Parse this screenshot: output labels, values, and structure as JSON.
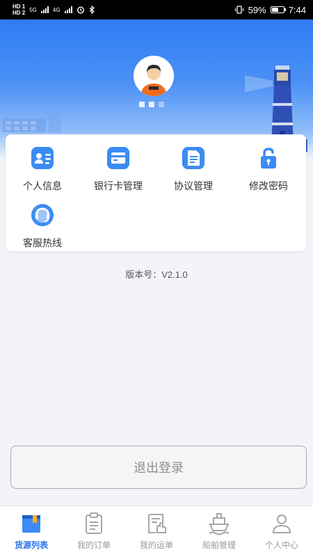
{
  "status_bar": {
    "hd_top": "HD 1",
    "hd_bottom": "HD 2",
    "net1": "5G",
    "net2": "4G",
    "battery_percent": "59%",
    "battery_level": 0.59,
    "time": "7:44"
  },
  "menu": [
    {
      "label": "个人信息",
      "icon": "id-card-icon"
    },
    {
      "label": "银行卡管理",
      "icon": "bank-card-icon"
    },
    {
      "label": "协议管理",
      "icon": "document-icon"
    },
    {
      "label": "修改密码",
      "icon": "unlock-icon"
    },
    {
      "label": "客服热线",
      "icon": "headset-icon"
    }
  ],
  "version": "版本号：V2.1.0",
  "logout_label": "退出登录",
  "tabs": [
    {
      "label": "货源列表",
      "icon": "book-icon",
      "active": true
    },
    {
      "label": "我的订单",
      "icon": "clipboard-icon",
      "active": false
    },
    {
      "label": "我的运单",
      "icon": "waybill-icon",
      "active": false
    },
    {
      "label": "船舶管理",
      "icon": "ship-icon",
      "active": false
    },
    {
      "label": "个人中心",
      "icon": "person-icon",
      "active": false
    }
  ],
  "colors": {
    "primary": "#2f7bf2",
    "active_tab": "#2f6fe6",
    "inactive_tab": "#9a9a9a"
  }
}
